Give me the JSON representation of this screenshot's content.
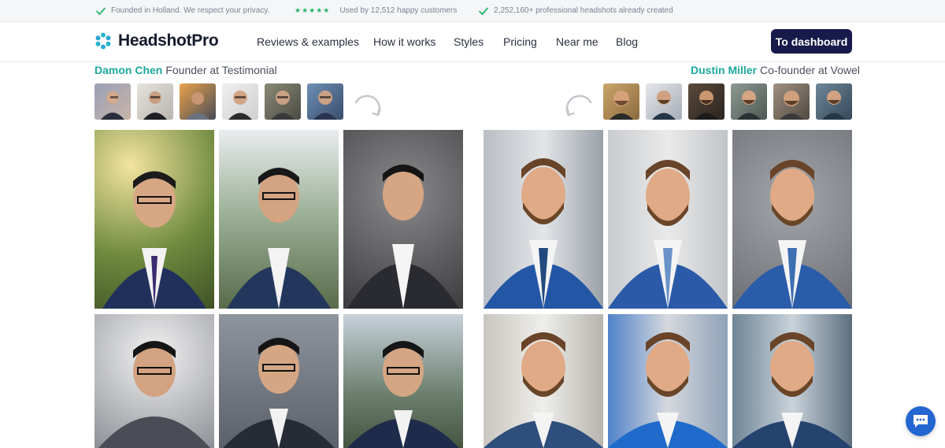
{
  "trust_bar": {
    "items": [
      "Founded in Holland. We respect your privacy.",
      "Used by 12,512 happy customers",
      "2,252,160+ professional headshots already created"
    ],
    "stars": "★★★★★"
  },
  "header": {
    "brand": "HeadshotPro",
    "nav": [
      "Reviews & examples",
      "How it works",
      "Styles",
      "Pricing",
      "Near me",
      "Blog"
    ],
    "cta": "To dashboard"
  },
  "testimonials": [
    {
      "name": "Damon Chen",
      "role": "Founder at Testimonial",
      "photo_tones": [
        "#6d7a4a",
        "#7b8f78",
        "#4a4a4c",
        "#5a6270",
        "#7d8a95",
        "#6d8a6a"
      ],
      "input_thumb_count": 6
    },
    {
      "name": "Dustin Miller",
      "role": "Co-founder at Vowel",
      "photo_tones": [
        "#9ea5ab",
        "#c8cbce",
        "#8e9398",
        "#b8bdc2",
        "#4d7cc0",
        "#7a8e9e"
      ],
      "input_thumb_count": 6
    }
  ],
  "colors": {
    "accent_teal": "#1ca89e",
    "cta_navy": "#171a4a",
    "check_green": "#25b46b",
    "chat_blue": "#2366d1"
  },
  "icons": [
    "check-icon",
    "star-icon",
    "logo-icon",
    "arrow-curve-icon",
    "chat-icon"
  ]
}
